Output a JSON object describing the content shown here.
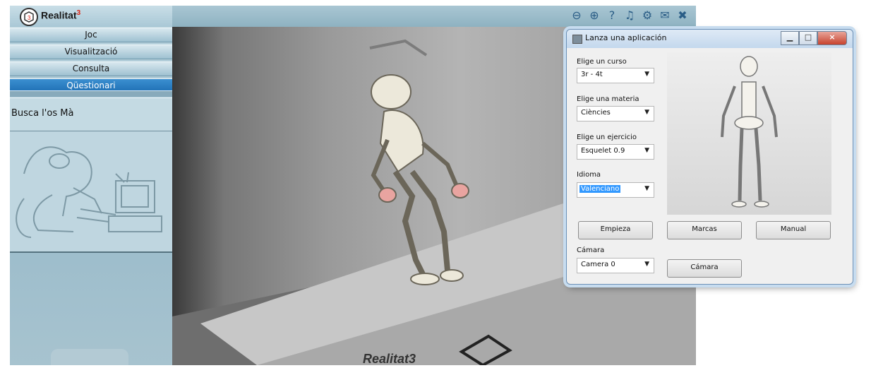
{
  "app": {
    "name": "Realitat",
    "name_suffix": "3",
    "menu": [
      {
        "label": "Joc"
      },
      {
        "label": "Visualització"
      },
      {
        "label": "Consulta"
      },
      {
        "label": "Qüestionari",
        "active": true
      }
    ],
    "task_label": "Busca l'os Mà",
    "toolbar": [
      "zoom-out-icon",
      "zoom-in-icon",
      "help-icon",
      "sound-icon",
      "settings-icon",
      "book-icon",
      "tools-icon"
    ],
    "marker_text": "Realitat3"
  },
  "dialog": {
    "title": "Lanza una aplicación",
    "curso_label": "Elige un curso",
    "curso_value": "3r - 4t",
    "materia_label": "Elige una materia",
    "materia_value": "Ciències",
    "ejercicio_label": "Elige un ejercicio",
    "ejercicio_value": "Esquelet 0.9",
    "idioma_label": "Idioma",
    "idioma_value": "Valenciano",
    "buttons": {
      "start": "Empieza",
      "marks": "Marcas",
      "manual": "Manual",
      "camera": "Cámara"
    },
    "camara_label": "Cámara",
    "camara_value": "Camera 0"
  },
  "colors": {
    "accent": "#1e6fb4",
    "marker_red": "#d21"
  }
}
